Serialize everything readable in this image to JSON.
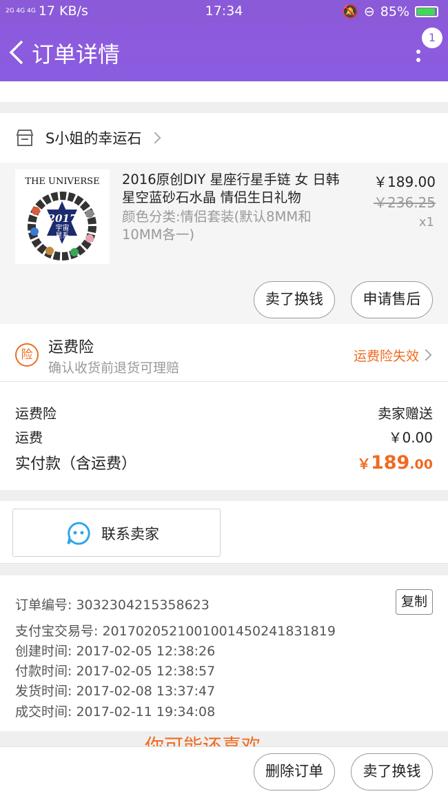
{
  "status_bar": {
    "signal": "2G 4G 4G",
    "speed": "17 KB/s",
    "time": "17:34",
    "battery": "85%"
  },
  "nav": {
    "title": "订单详情",
    "badge": "1"
  },
  "shop": {
    "name": "S小姐的幸运石"
  },
  "item": {
    "image_text_top": "THE UNIVERSE",
    "image_text_mid": "2017",
    "image_text_sub": "宇宙\n星系",
    "title": "2016原创DIY 星座行星手链 女 日韩星空蓝砂石水晶 情侣生日礼物",
    "sku": "颜色分类:情侣套装(默认8MM和10MM各一)",
    "price": "￥189.00",
    "original_price": "￥236.25",
    "quantity": "x1",
    "buttons": {
      "resell": "卖了换钱",
      "after_sale": "申请售后"
    }
  },
  "insurance": {
    "icon_text": "险",
    "title": "运费险",
    "subtitle": "确认收货前退货可理赔",
    "status": "运费险失效"
  },
  "fees": {
    "insurance_label": "运费险",
    "insurance_value": "卖家赠送",
    "shipping_label": "运费",
    "shipping_value": "￥0.00",
    "total_label": "实付款（含运费）",
    "total_currency": "￥",
    "total_int": "189",
    "total_dec": ".00"
  },
  "contact": {
    "label": "联系卖家"
  },
  "order_info": {
    "order_no": "订单编号: 3032304215358623",
    "copy_label": "复制",
    "alipay_no": "支付宝交易号: 2017020521001001450241831819",
    "created": "创建时间: 2017-02-05 12:38:26",
    "paid": "付款时间: 2017-02-05 12:38:57",
    "shipped": "发货时间: 2017-02-08 13:37:47",
    "completed": "成交时间: 2017-02-11 19:34:08"
  },
  "peek_text": "你可能还喜欢",
  "footer": {
    "delete": "删除订单",
    "resell": "卖了换钱"
  },
  "colors": {
    "nav": "#8a5ad8",
    "accent": "#ef6b1f",
    "contact_icon": "#2aa7e8"
  }
}
